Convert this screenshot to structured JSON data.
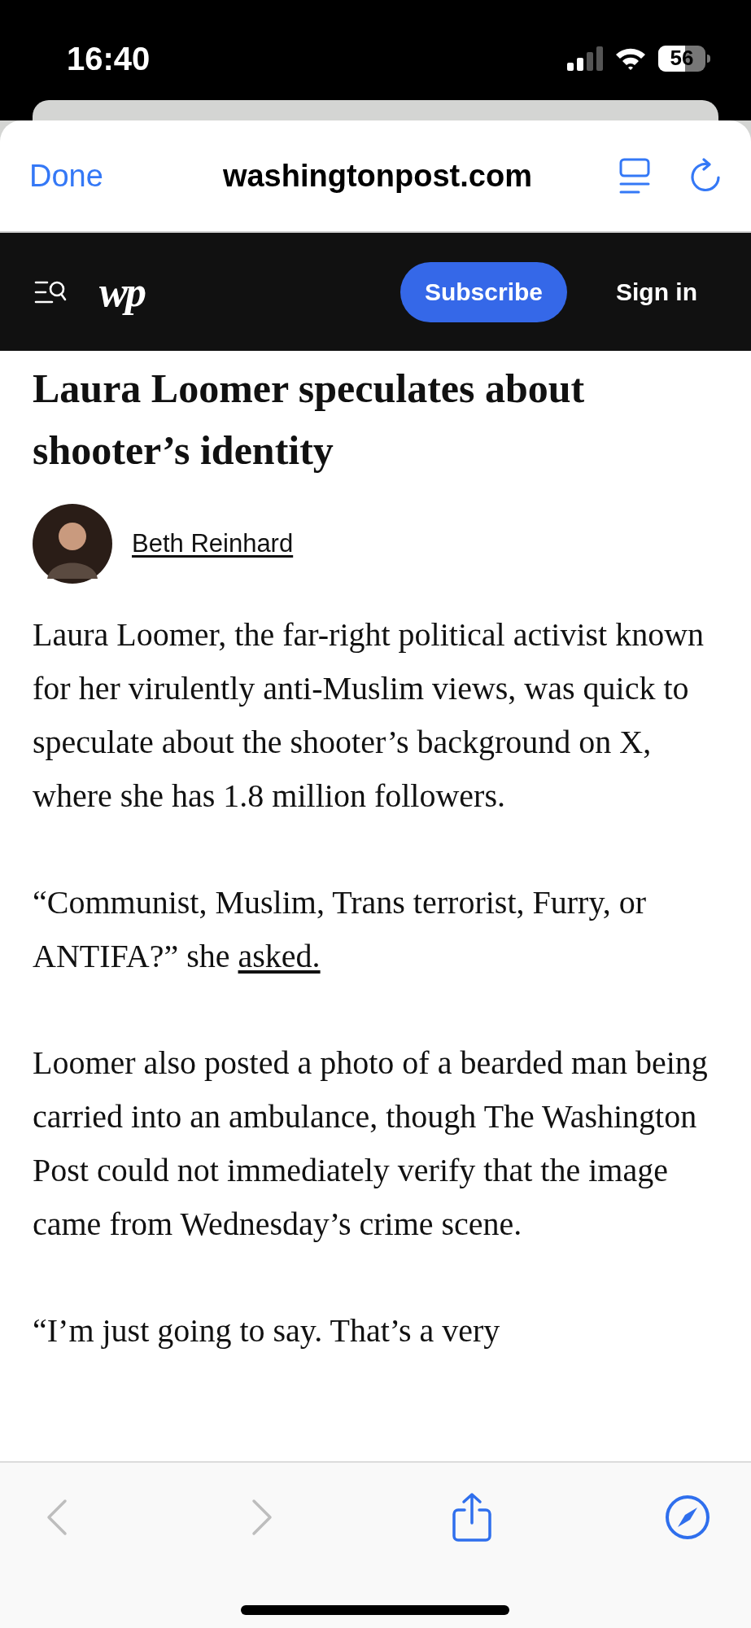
{
  "status_bar": {
    "time": "16:40",
    "battery": "56"
  },
  "browser": {
    "done": "Done",
    "domain": "washingtonpost.com"
  },
  "site_nav": {
    "logo": "wp",
    "subscribe": "Subscribe",
    "sign_in": "Sign in"
  },
  "article": {
    "headline": "Laura Loomer speculates about shooter’s identity",
    "author": "Beth Reinhard",
    "paragraphs": [
      {
        "text": "Laura Loomer, the far-right political activist known for her virulently anti-Muslim views, was quick to speculate about the shooter’s background on X, where she has 1.8 million followers."
      },
      {
        "text": "“Communist, Muslim, Trans terrorist, Furry, or ANTIFA?” she",
        "link": "asked."
      },
      {
        "text": "Loomer also posted a photo of a bearded man being carried into an ambulance, though The Washington Post could not immediately verify that the image came from Wednesday’s crime scene."
      },
      {
        "text": "“I’m just going to say. That’s a very"
      }
    ]
  },
  "toolbar": {
    "back": {
      "disabled": true
    },
    "forward": {
      "disabled": true
    }
  }
}
